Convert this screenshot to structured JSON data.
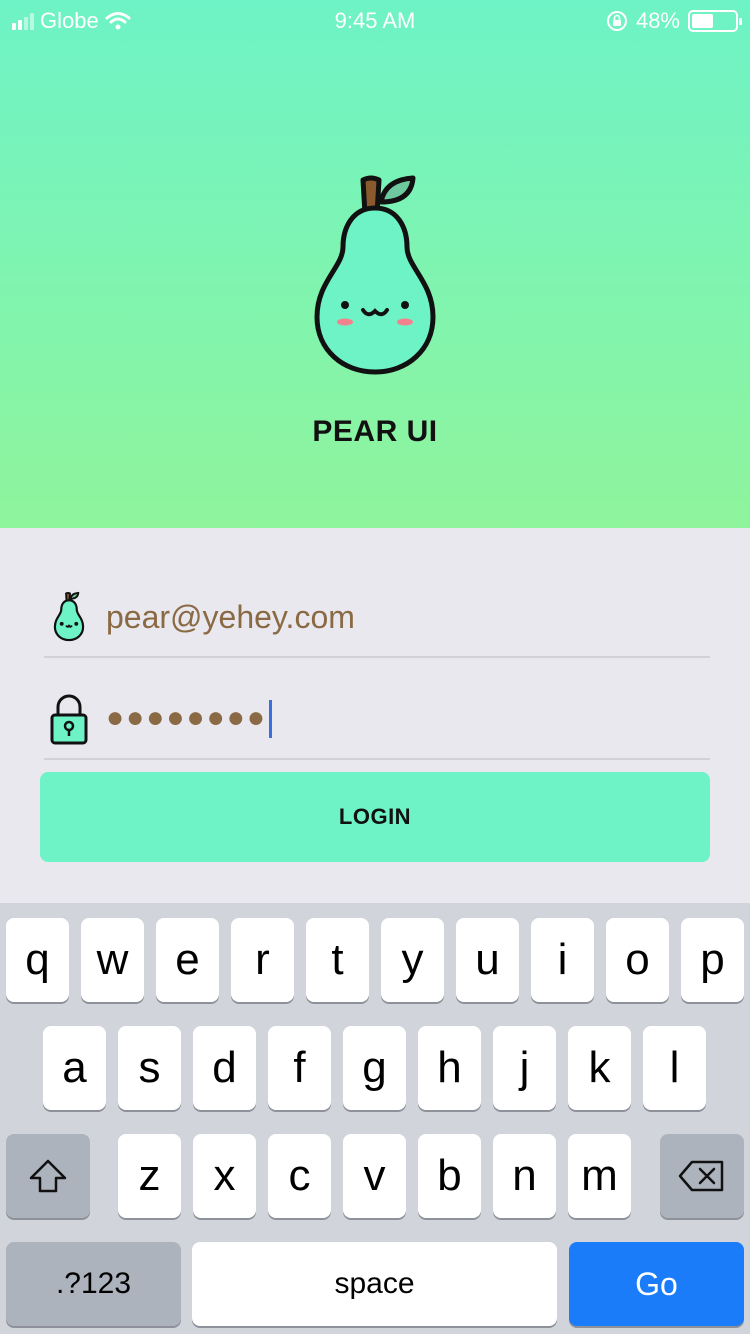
{
  "status_bar": {
    "carrier": "Globe",
    "time": "9:45 AM",
    "battery_percent": "48%",
    "battery_level": 0.48
  },
  "app": {
    "title": "PEAR UI"
  },
  "form": {
    "email_value": "pear@yehey.com",
    "password_masked": "●●●●●●●●",
    "login_label": "LOGIN"
  },
  "colors": {
    "accent": "#6ef3c6",
    "gradient_bottom": "#8ff49c",
    "input_text": "#8a6a44",
    "go_key": "#1a7cf9"
  },
  "keyboard": {
    "row1": [
      "q",
      "w",
      "e",
      "r",
      "t",
      "y",
      "u",
      "i",
      "o",
      "p"
    ],
    "row2": [
      "a",
      "s",
      "d",
      "f",
      "g",
      "h",
      "j",
      "k",
      "l"
    ],
    "row3": [
      "z",
      "x",
      "c",
      "v",
      "b",
      "n",
      "m"
    ],
    "shift_icon": "shift-icon",
    "delete_icon": "backspace-icon",
    "numbers_label": ".?123",
    "space_label": "space",
    "go_label": "Go"
  }
}
